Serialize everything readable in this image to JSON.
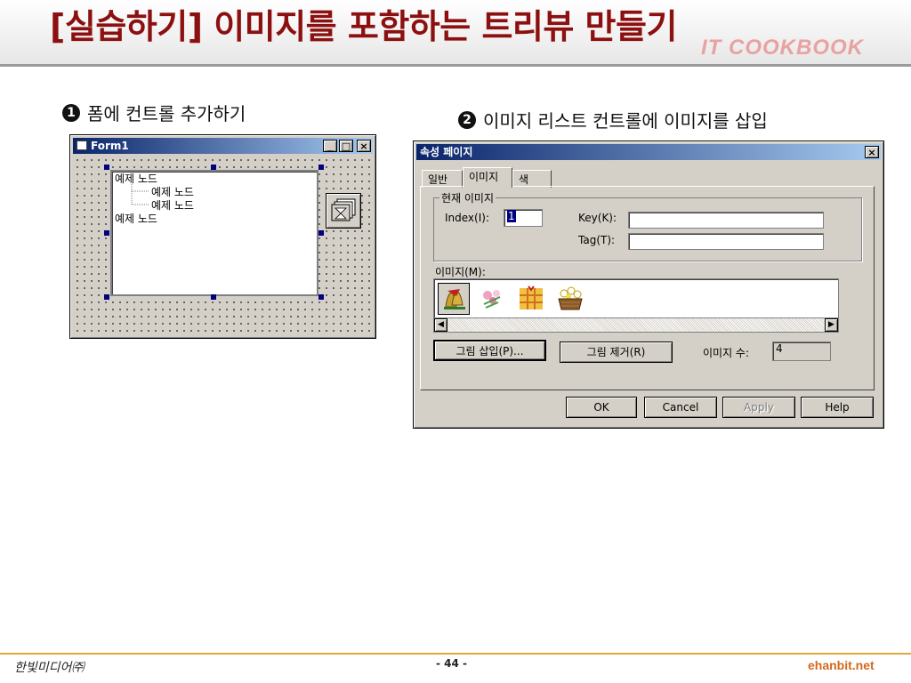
{
  "slide": {
    "title": "[실습하기] 이미지를 포함하는 트리뷰 만들기",
    "brand": "IT COOKBOOK",
    "step1": {
      "num": "1",
      "text": "폼에 컨트롤 추가하기"
    },
    "step2": {
      "num": "2",
      "text": "이미지 리스트 컨트롤에 이미지를 삽입"
    }
  },
  "form1": {
    "title": "Form1",
    "buttons": {
      "minimize": "_",
      "maximize": "□",
      "close": "×"
    },
    "tree": [
      "예제 노드",
      "예제 노드",
      "예제 노드",
      "예제 노드"
    ]
  },
  "dialog": {
    "title": "속성 페이지",
    "close": "×",
    "tabs": [
      "일반",
      "이미지",
      "색"
    ],
    "group_label": "현재 이미지",
    "index_label": "Index(I):",
    "index_value": "1",
    "key_label": "Key(K):",
    "tag_label": "Tag(T):",
    "images_label": "이미지(M):",
    "images": [
      "bells",
      "flowers",
      "gifts",
      "basket"
    ],
    "insert_button": "그림 삽입(P)...",
    "remove_button": "그림 제거(R)",
    "count_label": "이미지 수:",
    "count_value": "4",
    "ok": "OK",
    "cancel": "Cancel",
    "apply": "Apply",
    "help": "Help"
  },
  "footer": {
    "left": "한빛미디어㈜",
    "page": "- 44 -",
    "right": "ehanbit.net"
  },
  "colors": {
    "title": "#8c1010",
    "brand": "#e8a2a2",
    "footer_rule": "#e3a63a",
    "footer_brand": "#d2691e"
  }
}
